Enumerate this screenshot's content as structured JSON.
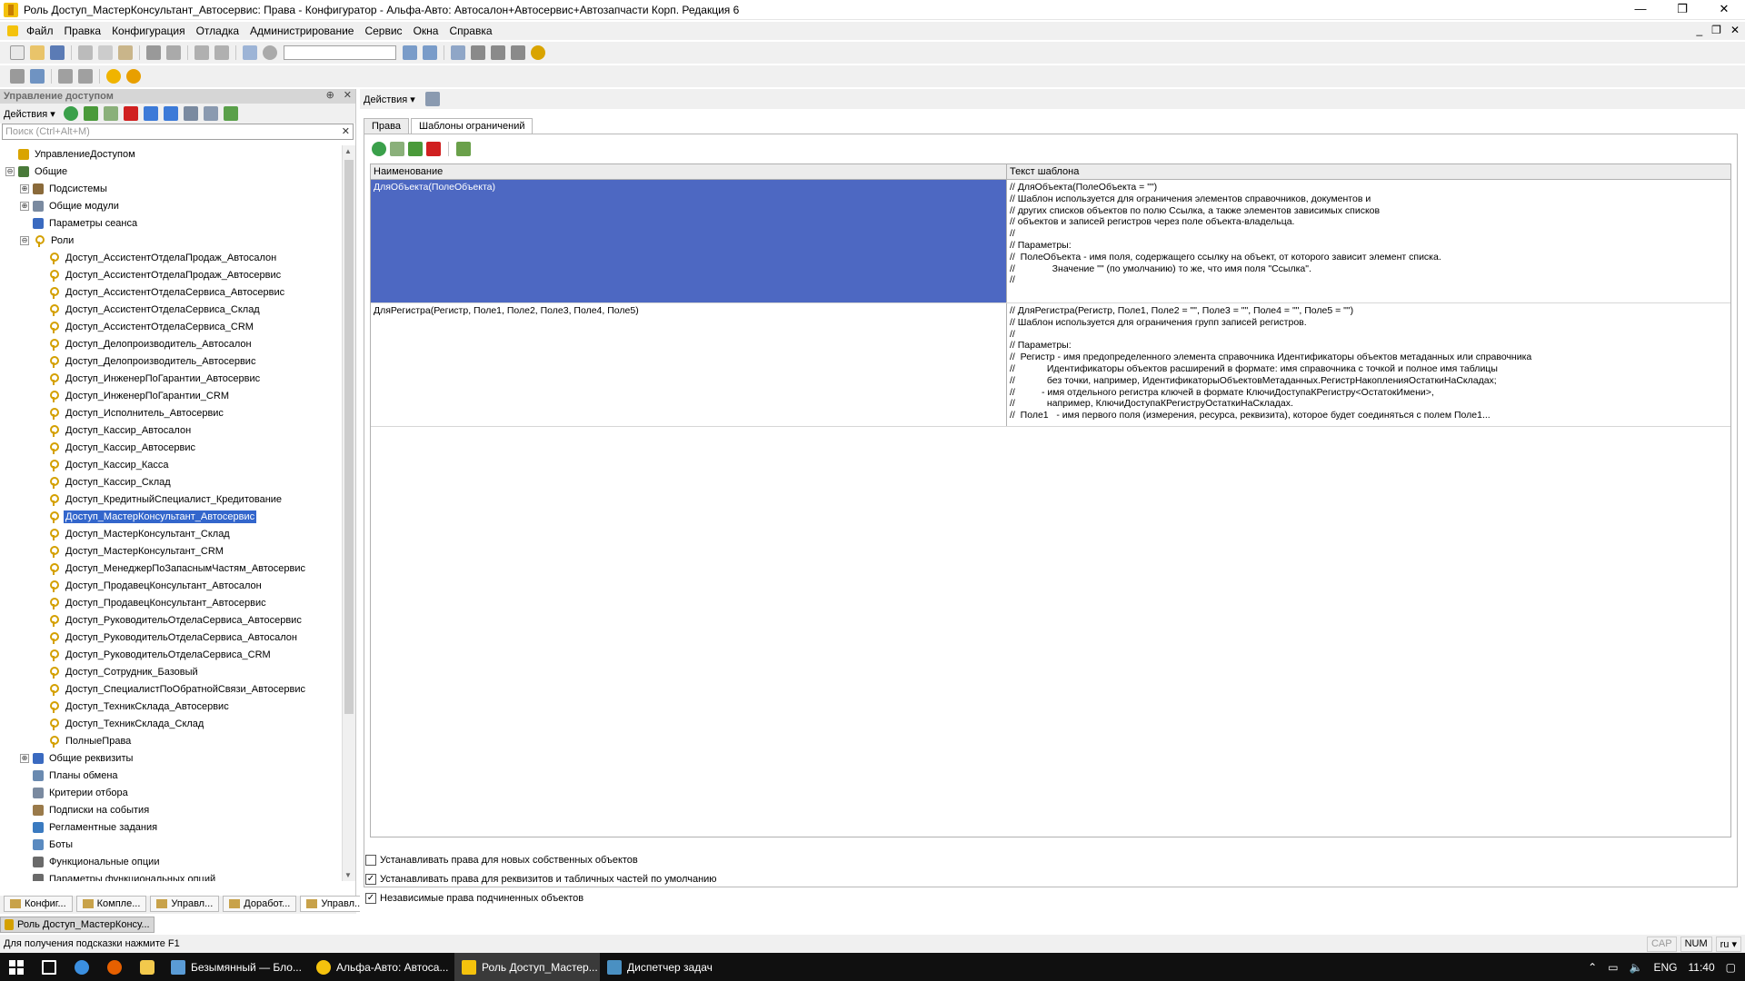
{
  "window": {
    "title": "Роль Доступ_МастерКонсультант_Автосервис: Права - Конфигуратор - Альфа-Авто: Автосалон+Автосервис+Автозапчасти Корп. Редакция 6",
    "min": "—",
    "max": "❐",
    "close": "✕"
  },
  "menu": [
    "Файл",
    "Правка",
    "Конфигурация",
    "Отладка",
    "Администрирование",
    "Сервис",
    "Окна",
    "Справка"
  ],
  "mdi": {
    "min": "_",
    "restore": "❐",
    "close": "✕"
  },
  "left": {
    "header": "Управление доступом",
    "pin": "⊕",
    "close": "✕",
    "actions": "Действия ▾",
    "search_placeholder": "Поиск (Ctrl+Alt+M)",
    "clear": "✕",
    "tree": [
      {
        "label": "УправлениеДоступом",
        "level": 0,
        "exp": "",
        "icon": "folder"
      },
      {
        "label": "Общие",
        "level": 0,
        "exp": "⊖",
        "icon": "gear"
      },
      {
        "label": "Подсистемы",
        "level": 1,
        "exp": "⊕",
        "icon": "sub"
      },
      {
        "label": "Общие модули",
        "level": 1,
        "exp": "⊕",
        "icon": "module"
      },
      {
        "label": "Параметры сеанса",
        "level": 1,
        "exp": "",
        "icon": "param"
      },
      {
        "label": "Роли",
        "level": 1,
        "exp": "⊖",
        "icon": "key"
      },
      {
        "label": "Доступ_АссистентОтделаПродаж_Автосалон",
        "level": 2,
        "exp": "",
        "icon": "key"
      },
      {
        "label": "Доступ_АссистентОтделаПродаж_Автосервис",
        "level": 2,
        "exp": "",
        "icon": "key"
      },
      {
        "label": "Доступ_АссистентОтделаСервиса_Автосервис",
        "level": 2,
        "exp": "",
        "icon": "key"
      },
      {
        "label": "Доступ_АссистентОтделаСервиса_Склад",
        "level": 2,
        "exp": "",
        "icon": "key"
      },
      {
        "label": "Доступ_АссистентОтделаСервиса_CRM",
        "level": 2,
        "exp": "",
        "icon": "key"
      },
      {
        "label": "Доступ_Делопроизводитель_Автосалон",
        "level": 2,
        "exp": "",
        "icon": "key"
      },
      {
        "label": "Доступ_Делопроизводитель_Автосервис",
        "level": 2,
        "exp": "",
        "icon": "key"
      },
      {
        "label": "Доступ_ИнженерПоГарантии_Автосервис",
        "level": 2,
        "exp": "",
        "icon": "key"
      },
      {
        "label": "Доступ_ИнженерПоГарантии_CRM",
        "level": 2,
        "exp": "",
        "icon": "key"
      },
      {
        "label": "Доступ_Исполнитель_Автосервис",
        "level": 2,
        "exp": "",
        "icon": "key"
      },
      {
        "label": "Доступ_Кассир_Автосалон",
        "level": 2,
        "exp": "",
        "icon": "key"
      },
      {
        "label": "Доступ_Кассир_Автосервис",
        "level": 2,
        "exp": "",
        "icon": "key"
      },
      {
        "label": "Доступ_Кассир_Касса",
        "level": 2,
        "exp": "",
        "icon": "key"
      },
      {
        "label": "Доступ_Кассир_Склад",
        "level": 2,
        "exp": "",
        "icon": "key"
      },
      {
        "label": "Доступ_КредитныйСпециалист_Кредитование",
        "level": 2,
        "exp": "",
        "icon": "key"
      },
      {
        "label": "Доступ_МастерКонсультант_Автосервис",
        "level": 2,
        "exp": "",
        "icon": "key",
        "selected": true
      },
      {
        "label": "Доступ_МастерКонсультант_Склад",
        "level": 2,
        "exp": "",
        "icon": "key"
      },
      {
        "label": "Доступ_МастерКонсультант_CRM",
        "level": 2,
        "exp": "",
        "icon": "key"
      },
      {
        "label": "Доступ_МенеджерПоЗапаснымЧастям_Автосервис",
        "level": 2,
        "exp": "",
        "icon": "key"
      },
      {
        "label": "Доступ_ПродавецКонсультант_Автосалон",
        "level": 2,
        "exp": "",
        "icon": "key"
      },
      {
        "label": "Доступ_ПродавецКонсультант_Автосервис",
        "level": 2,
        "exp": "",
        "icon": "key"
      },
      {
        "label": "Доступ_РуководительОтделаСервиса_Автосервис",
        "level": 2,
        "exp": "",
        "icon": "key"
      },
      {
        "label": "Доступ_РуководительОтделаСервиса_Автосалон",
        "level": 2,
        "exp": "",
        "icon": "key"
      },
      {
        "label": "Доступ_РуководительОтделаСервиса_CRM",
        "level": 2,
        "exp": "",
        "icon": "key"
      },
      {
        "label": "Доступ_Сотрудник_Базовый",
        "level": 2,
        "exp": "",
        "icon": "key"
      },
      {
        "label": "Доступ_СпециалистПоОбратнойСвязи_Автосервис",
        "level": 2,
        "exp": "",
        "icon": "key"
      },
      {
        "label": "Доступ_ТехникСклада_Автосервис",
        "level": 2,
        "exp": "",
        "icon": "key"
      },
      {
        "label": "Доступ_ТехникСклада_Склад",
        "level": 2,
        "exp": "",
        "icon": "key"
      },
      {
        "label": "ПолныеПрава",
        "level": 2,
        "exp": "",
        "icon": "key"
      },
      {
        "label": "Общие реквизиты",
        "level": 1,
        "exp": "⊕",
        "icon": "attr"
      },
      {
        "label": "Планы обмена",
        "level": 1,
        "exp": "",
        "icon": "plan"
      },
      {
        "label": "Критерии отбора",
        "level": 1,
        "exp": "",
        "icon": "filter"
      },
      {
        "label": "Подписки на события",
        "level": 1,
        "exp": "",
        "icon": "event"
      },
      {
        "label": "Регламентные задания",
        "level": 1,
        "exp": "",
        "icon": "clock"
      },
      {
        "label": "Боты",
        "level": 1,
        "exp": "",
        "icon": "bot"
      },
      {
        "label": "Функциональные опции",
        "level": 1,
        "exp": "",
        "icon": "fopt"
      },
      {
        "label": "Параметры функциональных опций",
        "level": 1,
        "exp": "",
        "icon": "fpar"
      }
    ],
    "bottom_tabs": [
      "Конфиг...",
      "Компле...",
      "Управл...",
      "Доработ...",
      "Управл..."
    ]
  },
  "window_tab": "Роль Доступ_МастерКонсу...",
  "right": {
    "actions": "Действия ▾",
    "tabs": [
      "Права",
      "Шаблоны ограничений"
    ],
    "columns": [
      "Наименование",
      "Текст шаблона"
    ],
    "rows": [
      {
        "name": "ДляОбъекта(ПолеОбъекта)",
        "text": "// ДляОбъекта(ПолеОбъекта = \"\")\n// Шаблон используется для ограничения элементов справочников, документов и\n// других списков объектов по полю Ссылка, а также элементов зависимых списков\n// объектов и записей регистров через поле объекта-владельца.\n//\n// Параметры:\n//  ПолеОбъекта - имя поля, содержащего ссылку на объект, от которого зависит элемент списка.\n//              Значение \"\" (по умолчанию) то же, что имя поля \"Ссылка\".\n//"
      },
      {
        "name": "ДляРегистра(Регистр, Поле1, Поле2, Поле3, Поле4, Поле5)",
        "text": "// ДляРегистра(Регистр, Поле1, Поле2 = \"\", Поле3 = \"\", Поле4 = \"\", Поле5 = \"\")\n// Шаблон используется для ограничения групп записей регистров.\n//\n// Параметры:\n//  Регистр - имя предопределенного элемента справочника Идентификаторы объектов метаданных или справочника\n//            Идентификаторы объектов расширений в формате: имя справочника с точкой и полное имя таблицы\n//            без точки, например, ИдентификаторыОбъектовМетаданных.РегистрНакопленияОстаткиНаСкладах;\n//          - имя отдельного регистра ключей в формате КлючиДоступаКРегистру<ОстатокИмени>,\n//            например, КлючиДоступаКРегиструОстаткиНаСкладах.\n//  Поле1   - имя первого поля (измерения, ресурса, реквизита), которое будет соединяться с полем Поле1..."
      }
    ],
    "checkboxes": [
      {
        "label": "Устанавливать права для новых собственных объектов",
        "checked": false
      },
      {
        "label": "Устанавливать права для реквизитов и табличных частей по умолчанию",
        "checked": true
      },
      {
        "label": "Независимые права подчиненных объектов",
        "checked": true
      }
    ],
    "check_mark": "✓"
  },
  "status": {
    "hint": "Для получения подсказки нажмите F1",
    "cap": "CAP",
    "num": "NUM",
    "lang": "ru ▾"
  },
  "taskbar": {
    "apps": [
      "Безымянный — Бло...",
      "Альфа-Авто: Автоса...",
      "Роль Доступ_Мастер...",
      "Диспетчер задач"
    ],
    "lang": "ENG",
    "time": "11:40"
  },
  "colors": {
    "selection": "#3366cc",
    "row_selection": "#4d68c2"
  }
}
